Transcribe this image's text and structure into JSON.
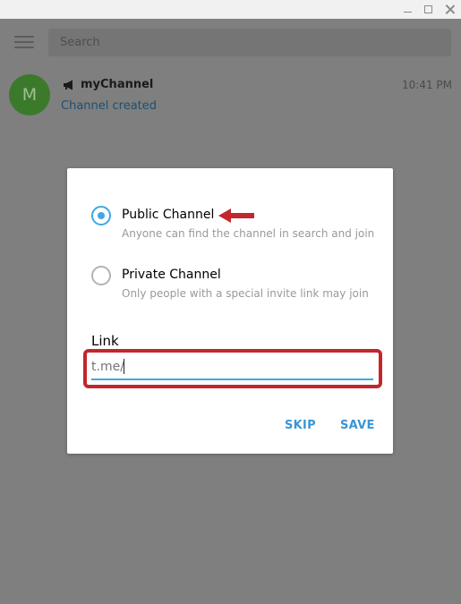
{
  "sidebar": {
    "search_placeholder": "Search",
    "chat": {
      "avatar_letter": "M",
      "name": "myChannel",
      "time": "10:41 PM",
      "preview": "Channel created"
    }
  },
  "dialog": {
    "options": [
      {
        "label": "Public Channel",
        "description": "Anyone can find the channel in search and join",
        "selected": true
      },
      {
        "label": "Private Channel",
        "description": "Only people with a special invite link may join",
        "selected": false
      }
    ],
    "link_label": "Link",
    "link_placeholder": "t.me/",
    "skip_label": "SKIP",
    "save_label": "SAVE"
  },
  "colors": {
    "accent": "#40a7e3",
    "annotation_red": "#c1272d",
    "avatar": "#3b7a2b"
  },
  "icons": [
    "minimize-icon",
    "maximize-icon",
    "close-icon",
    "hamburger-menu-icon",
    "megaphone-channel-icon",
    "red-arrow-annotation"
  ]
}
